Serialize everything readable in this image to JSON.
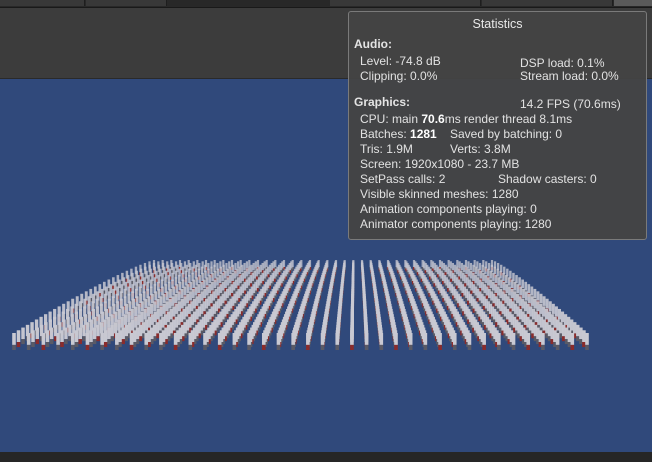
{
  "stats": {
    "title": "Statistics",
    "audio_header": "Audio:",
    "level": "Level: -74.8 dB",
    "dsp_load": "DSP load: 0.1%",
    "clipping": "Clipping: 0.0%",
    "stream_load": "Stream load: 0.0%",
    "graphics_header": "Graphics:",
    "fps": "14.2 FPS (70.6ms)",
    "cpu_prefix": "CPU: main ",
    "cpu_main": "70.6",
    "cpu_suffix": "ms  render thread 8.1ms",
    "batches_prefix": "Batches: ",
    "batches_value": "1281",
    "saved_by_batching": "Saved by batching: 0",
    "tris": "Tris: 1.9M",
    "verts": "Verts: 3.8M",
    "screen": "Screen: 1920x1080 - 23.7 MB",
    "setpass": "SetPass calls: 2",
    "shadow_casters": "Shadow casters: 0",
    "visible_skinned": "Visible skinned meshes: 1280",
    "animation_components": "Animation components playing: 0",
    "animator_components": "Animator components playing: 1280"
  },
  "scene": {
    "background_color": "#30497b",
    "character_rows": 32,
    "character_columns": 40,
    "character_color": "#c9c9d2",
    "accent_color": "#8a2c2c"
  }
}
